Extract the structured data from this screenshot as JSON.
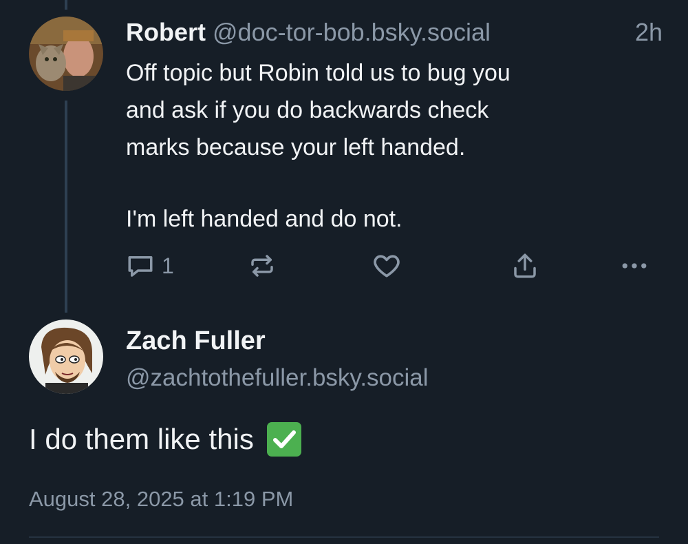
{
  "reply": {
    "author_name": "Robert",
    "author_handle": "@doc-tor-bob.bsky.social",
    "time_ago": "2h",
    "text_lines": [
      "Off topic but Robin told us to bug you",
      "and ask if you do backwards check",
      "marks because your left handed."
    ],
    "text_followup": "I'm left handed and do not.",
    "actions": {
      "reply_icon": "speech-bubble-icon",
      "reply_count": "1",
      "repost_icon": "repost-arrows-icon",
      "like_icon": "heart-icon",
      "share_icon": "share-upload-icon",
      "more_icon": "more-dots-icon"
    }
  },
  "post": {
    "author_name": "Zach Fuller",
    "author_handle": "@zachtothefuller.bsky.social",
    "text": "I do them like this",
    "emoji": "✅",
    "timestamp": "August 28, 2025 at 1:19 PM"
  },
  "colors": {
    "background": "#161e27",
    "primary_text": "#f1f3f5",
    "secondary_text": "#8b98a7",
    "thread_line": "#2e4052",
    "check_emoji_green": "#4cb050"
  }
}
